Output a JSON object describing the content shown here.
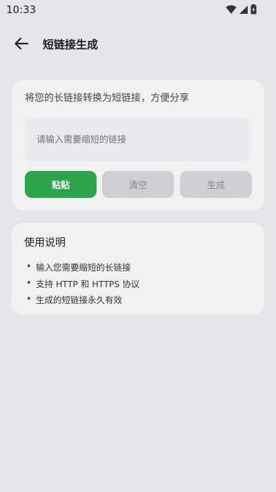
{
  "status_bar": {
    "time": "10:33",
    "icons": [
      "wifi-icon",
      "signal-icon",
      "battery-icon"
    ]
  },
  "app_bar": {
    "title": "短链接生成",
    "back_icon": "arrow-left-icon"
  },
  "converter": {
    "description": "将您的长链接转换为短链接，方便分享",
    "input_value": "",
    "input_placeholder": "请输入需要缩短的链接",
    "paste_label": "粘贴",
    "clear_label": "清空",
    "generate_label": "生成"
  },
  "help": {
    "title": "使用说明",
    "bullet": "•",
    "items": [
      "输入您需要缩短的长链接",
      "支持 HTTP 和 HTTPS 协议",
      "生成的短链接永久有效"
    ]
  },
  "colors": {
    "background": "#e4e5e9",
    "card": "#f1f1f4",
    "primary": "#2aa54d",
    "disabled_button": "#cdcfd3"
  }
}
